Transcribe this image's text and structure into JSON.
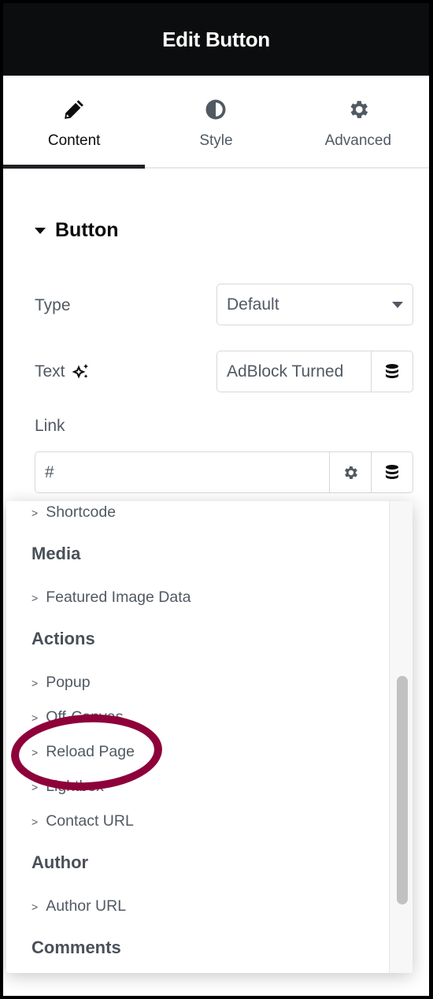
{
  "header": {
    "title": "Edit Button"
  },
  "tabs": [
    {
      "label": "Content",
      "icon": "pencil-icon",
      "active": true
    },
    {
      "label": "Style",
      "icon": "half-circle-icon",
      "active": false
    },
    {
      "label": "Advanced",
      "icon": "gear-icon",
      "active": false
    }
  ],
  "section": {
    "title": "Button",
    "icon": "caret-down-icon"
  },
  "fields": {
    "type": {
      "label": "Type",
      "value": "Default"
    },
    "text": {
      "label": "Text",
      "value": "AdBlock Turned",
      "ai_icon": "sparkle-icon",
      "dynamic_icon": "database-icon"
    },
    "link": {
      "label": "Link",
      "value": "#",
      "settings_icon": "gear-icon",
      "dynamic_icon": "database-icon"
    }
  },
  "dropdown": {
    "entries": [
      {
        "kind": "item",
        "label": "Shortcode"
      },
      {
        "kind": "group",
        "label": "Media"
      },
      {
        "kind": "item",
        "label": "Featured Image Data"
      },
      {
        "kind": "group",
        "label": "Actions"
      },
      {
        "kind": "item",
        "label": "Popup"
      },
      {
        "kind": "item",
        "label": "Off-Canvas"
      },
      {
        "kind": "item",
        "label": "Reload Page",
        "highlighted": true
      },
      {
        "kind": "item",
        "label": "Lightbox"
      },
      {
        "kind": "item",
        "label": "Contact URL"
      },
      {
        "kind": "group",
        "label": "Author"
      },
      {
        "kind": "item",
        "label": "Author URL"
      },
      {
        "kind": "group",
        "label": "Comments"
      }
    ],
    "item_chevron": ">"
  },
  "annotation": {
    "color": "#8e003a",
    "target": "Reload Page"
  }
}
